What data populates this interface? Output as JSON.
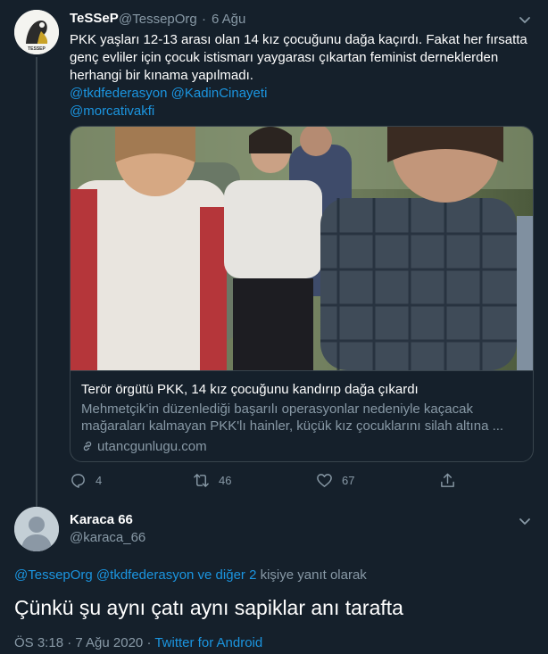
{
  "parent_tweet": {
    "display_name": "TeSSeP",
    "handle": "@TessepOrg",
    "separator": "·",
    "date": "6 Ağu",
    "text": "PKK yaşları 12-13 arası olan 14 kız çocuğunu dağa kaçırdı. Fakat her fırsatta genç evliler için çocuk istismarı yaygarası çıkartan feminist derneklerden herhangi bir kınama yapılmadı.",
    "mentions_line1": "@tkdfederasyon @KadinCinayeti",
    "mentions_line2": "@morcativakfi",
    "avatar_logo_text": "TESSEP",
    "card": {
      "title": "Terör örgütü PKK, 14 kız çocuğunu kandırıp dağa çıkardı",
      "description": "Mehmetçik'in düzenlediği başarılı operasyonlar nedeniyle kaçacak mağaraları kalmayan PKK'lı hainler, küçük kız çocuklarını silah altına ...",
      "domain": "utancgunlugu.com"
    },
    "actions": {
      "replies": "4",
      "retweets": "46",
      "likes": "67"
    }
  },
  "reply_tweet": {
    "display_name": "Karaca 66",
    "handle": "@karaca_66",
    "replying_mentions": "@TessepOrg @tkdfederasyon ve diğer 2",
    "replying_suffix": " kişiye yanıt olarak",
    "text": "Çünkü şu aynı çatı aynı sapiklar anı tarafta",
    "timestamp": "ÖS 3:18 · 7 Ağu 2020",
    "source_separator": " · ",
    "source": "Twitter for Android"
  },
  "colors": {
    "background": "#15202b",
    "muted": "#8899a6",
    "link": "#1b95e0",
    "border": "#38444d"
  }
}
